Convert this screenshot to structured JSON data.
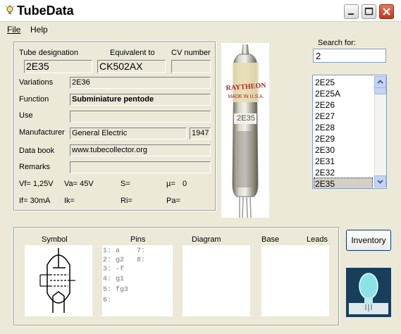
{
  "window": {
    "title": "TubeData",
    "icon": "lightbulb-icon"
  },
  "menu": [
    {
      "label": "File"
    },
    {
      "label": "Help"
    }
  ],
  "labels": {
    "tube_designation": "Tube designation",
    "equivalent_to": "Equivalent to",
    "cv_number": "CV number",
    "variations": "Variations",
    "function": "Function",
    "use": "Use",
    "manufacturer": "Manufacturer",
    "data_book": "Data book",
    "remarks": "Remarks",
    "search_for": "Search for:"
  },
  "fields": {
    "tube_designation": "2E35",
    "equivalent_to": "CK502AX",
    "cv_number": "",
    "variations": "2E36",
    "function": "Subminiature pentode",
    "use": "",
    "manufacturer": "General Electric",
    "year": "1947",
    "data_book": "www.tubecollector.org",
    "remarks": ""
  },
  "params": {
    "vf": "Vf= 1,25V",
    "va": "Va= 45V",
    "s": "S=",
    "mu": "µ=",
    "mu_value": "0",
    "if": "If= 30mA",
    "ik": "Ik=",
    "ri": "Ri=",
    "pa": "Pa="
  },
  "photo": {
    "brand": "RAYTHEON",
    "made_in": "MADE IN U.S.A.",
    "type": "2E35"
  },
  "search": {
    "value": "2"
  },
  "tube_list": {
    "items": [
      "2E25",
      "2E25A",
      "2E26",
      "2E27",
      "2E28",
      "2E29",
      "2E30",
      "2E31",
      "2E32",
      "2E35"
    ],
    "selected": "2E35"
  },
  "bottom": {
    "headers": {
      "symbol": "Symbol",
      "pins": "Pins",
      "diagram": "Diagram",
      "base": "Base",
      "leads": "Leads"
    },
    "pins_left": [
      "1: a",
      "2: g2",
      "3: -f",
      "4: g1",
      "5: fg3",
      "6:"
    ],
    "pins_right": [
      "7:",
      "8:"
    ]
  },
  "buttons": {
    "inventory": "Inventory"
  }
}
